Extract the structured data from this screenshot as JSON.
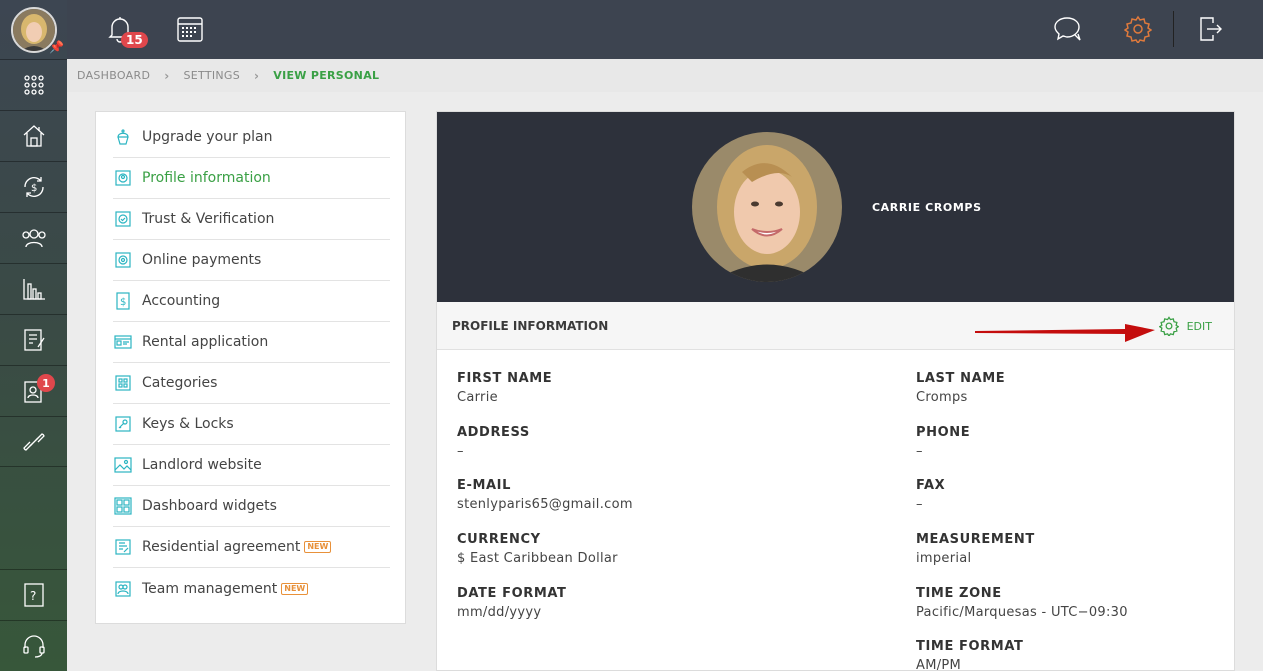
{
  "topbar": {
    "notification_count": "15"
  },
  "rail": {
    "badge_count": "1"
  },
  "breadcrumb": [
    "DASHBOARD",
    "SETTINGS",
    "VIEW PERSONAL"
  ],
  "menu": [
    {
      "label": "Upgrade your plan",
      "icon": "cupcake-icon"
    },
    {
      "label": "Profile information",
      "icon": "profile-icon",
      "active": true
    },
    {
      "label": "Trust & Verification",
      "icon": "verification-icon"
    },
    {
      "label": "Online payments",
      "icon": "payments-icon"
    },
    {
      "label": "Accounting",
      "icon": "dollar-icon"
    },
    {
      "label": "Rental application",
      "icon": "application-icon"
    },
    {
      "label": "Categories",
      "icon": "categories-icon"
    },
    {
      "label": "Keys & Locks",
      "icon": "key-icon"
    },
    {
      "label": "Landlord website",
      "icon": "image-icon"
    },
    {
      "label": "Dashboard widgets",
      "icon": "widgets-icon"
    },
    {
      "label": "Residential agreement",
      "icon": "agreement-icon",
      "badge": "NEW"
    },
    {
      "label": "Team management",
      "icon": "team-icon",
      "badge": "NEW"
    }
  ],
  "profile": {
    "name": "CARRIE CROMPS",
    "section_title": "PROFILE INFORMATION",
    "edit_label": "EDIT",
    "fields": {
      "first_name": {
        "label": "FIRST NAME",
        "value": "Carrie"
      },
      "last_name": {
        "label": "LAST NAME",
        "value": "Cromps"
      },
      "address": {
        "label": "ADDRESS",
        "value": "–"
      },
      "phone": {
        "label": "PHONE",
        "value": "–"
      },
      "email": {
        "label": "E-MAIL",
        "value": "stenlyparis65@gmail.com"
      },
      "fax": {
        "label": "FAX",
        "value": "–"
      },
      "currency": {
        "label": "CURRENCY",
        "value": "$ East Caribbean Dollar"
      },
      "measurement": {
        "label": "MEASUREMENT",
        "value": "imperial"
      },
      "date_format": {
        "label": "DATE FORMAT",
        "value": "mm/dd/yyyy"
      },
      "time_zone": {
        "label": "TIME ZONE",
        "value": "Pacific/Marquesas - UTC−09:30"
      },
      "time_format": {
        "label": "TIME FORMAT",
        "value": "AM/PM"
      }
    }
  },
  "colors": {
    "accent": "#3aa045",
    "badge": "#e0474c",
    "arrow": "#c40d0d",
    "hero_bg": "#2d313b"
  }
}
